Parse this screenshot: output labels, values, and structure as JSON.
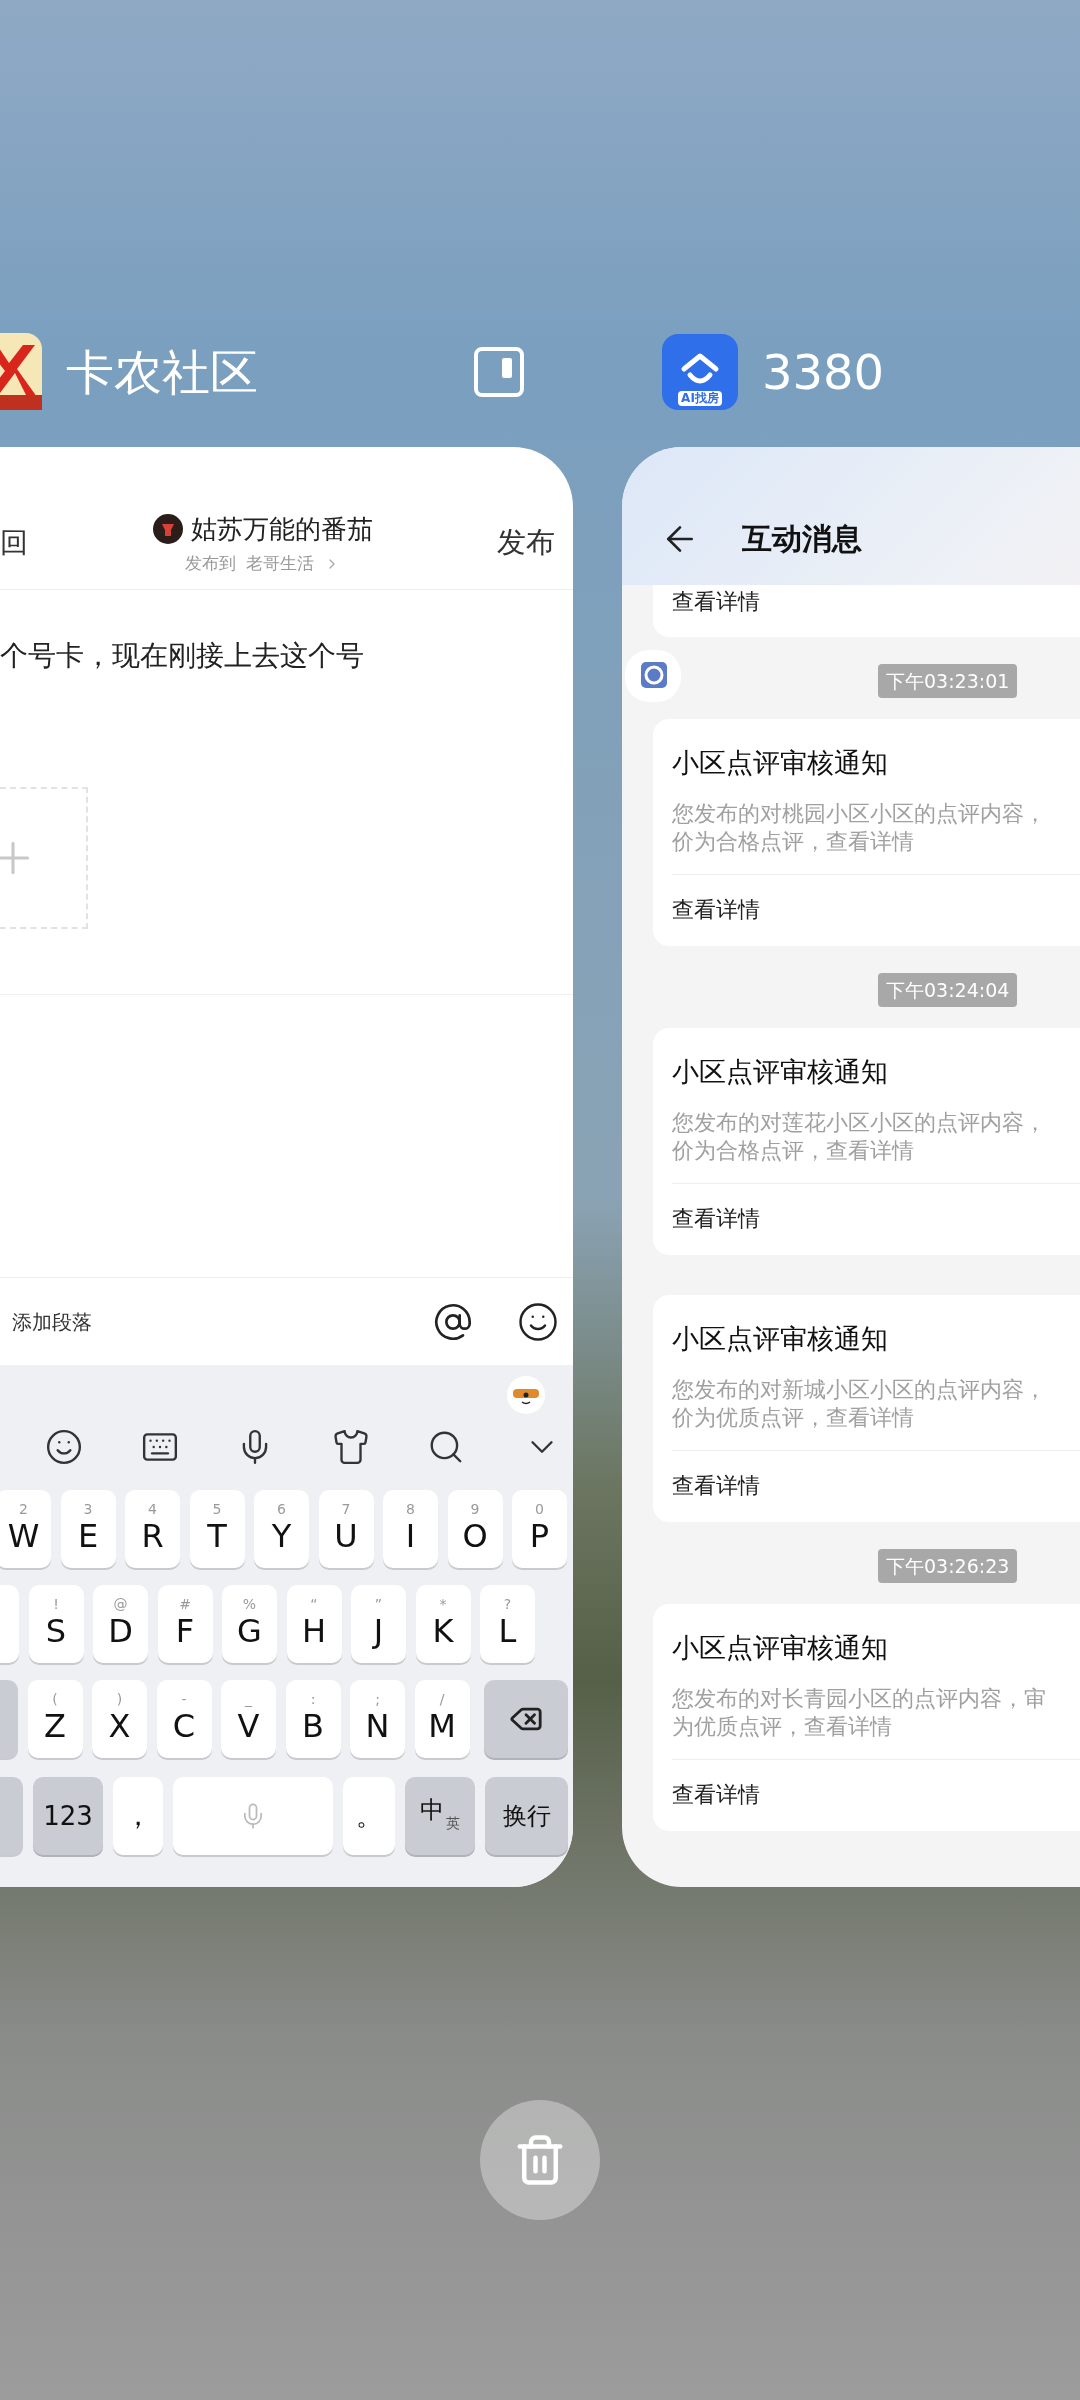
{
  "left_app": {
    "name": "卡农社区",
    "editor": {
      "back": "回",
      "author": "姑苏万能的番茄",
      "target_prefix": "发布到",
      "target": "老哥生活",
      "publish": "发布",
      "body": "个号卡，现在刚接上去这个号",
      "add_paragraph": "添加段落"
    },
    "keyboard": {
      "rows": [
        [
          {
            "letter": "W",
            "hint": "2"
          },
          {
            "letter": "E",
            "hint": "3"
          },
          {
            "letter": "R",
            "hint": "4"
          },
          {
            "letter": "T",
            "hint": "5"
          },
          {
            "letter": "Y",
            "hint": "6"
          },
          {
            "letter": "U",
            "hint": "7"
          },
          {
            "letter": "I",
            "hint": "8"
          },
          {
            "letter": "O",
            "hint": "9"
          },
          {
            "letter": "P",
            "hint": "0"
          }
        ],
        [
          {
            "letter": "S",
            "hint": "!"
          },
          {
            "letter": "D",
            "hint": "@"
          },
          {
            "letter": "F",
            "hint": "#"
          },
          {
            "letter": "G",
            "hint": "%"
          },
          {
            "letter": "H",
            "hint": "“"
          },
          {
            "letter": "J",
            "hint": "”"
          },
          {
            "letter": "K",
            "hint": "*"
          },
          {
            "letter": "L",
            "hint": "?"
          }
        ],
        [
          {
            "letter": "Z",
            "hint": "("
          },
          {
            "letter": "X",
            "hint": ")"
          },
          {
            "letter": "C",
            "hint": "-"
          },
          {
            "letter": "V",
            "hint": "_"
          },
          {
            "letter": "B",
            "hint": ":"
          },
          {
            "letter": "N",
            "hint": ";"
          },
          {
            "letter": "M",
            "hint": "/"
          }
        ]
      ],
      "bottom": {
        "numbers": "123",
        "comma": "，",
        "period": "。",
        "lang_main": "中",
        "lang_alt": "英",
        "enter": "换行"
      }
    }
  },
  "right_app": {
    "name": "3380",
    "icon_label": "AI找房",
    "title": "互动消息",
    "top_link": "查看详情",
    "messages": [
      {
        "time": "下午03:23:01",
        "title": "小区点评审核通知",
        "lines": [
          "您发布的对桃园小区小区的点评内容，",
          "价为合格点评，查看详情"
        ],
        "link": "查看详情"
      },
      {
        "time": "下午03:24:04",
        "title": "小区点评审核通知",
        "lines": [
          "您发布的对莲花小区小区的点评内容，",
          "价为合格点评，查看详情"
        ],
        "link": "查看详情"
      },
      {
        "title": "小区点评审核通知",
        "lines": [
          "您发布的对新城小区小区的点评内容，",
          "价为优质点评，查看详情"
        ],
        "link": "查看详情"
      },
      {
        "time": "下午03:26:23",
        "title": "小区点评审核通知",
        "lines": [
          "您发布的对长青园小区的点评内容，审",
          "为优质点评，查看详情"
        ],
        "link": "查看详情"
      }
    ]
  }
}
